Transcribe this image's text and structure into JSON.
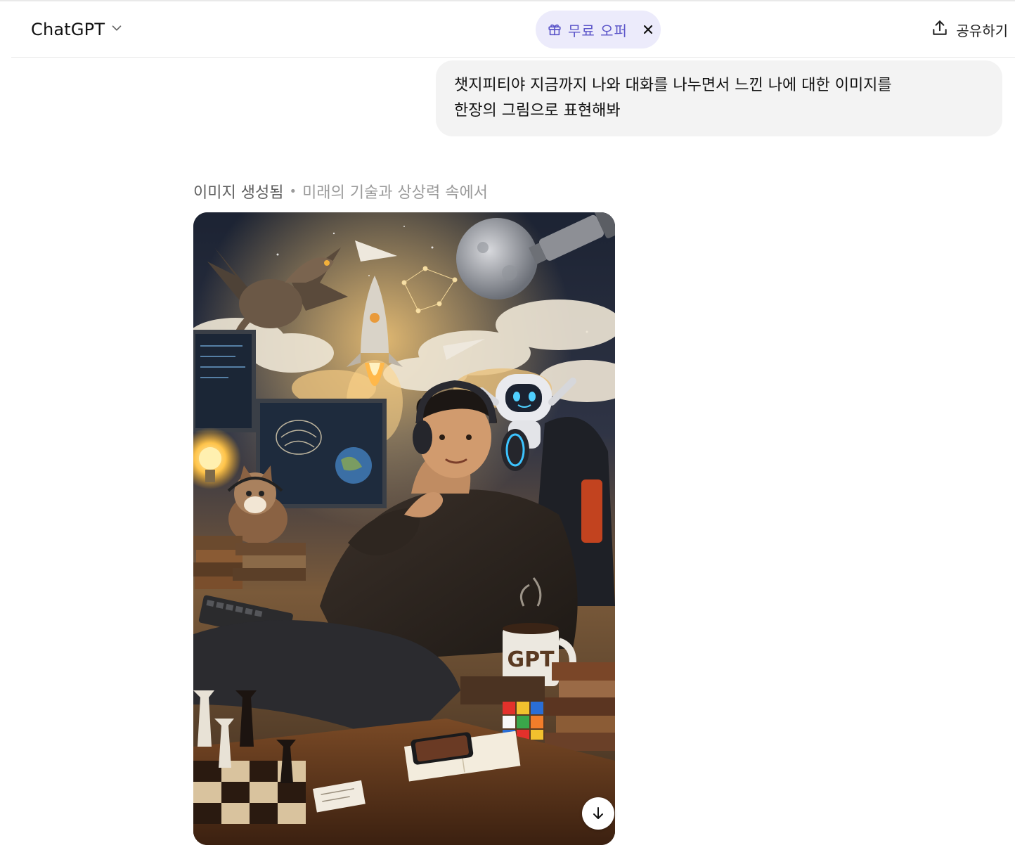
{
  "header": {
    "model_label": "ChatGPT",
    "offer_label": "무료 오퍼",
    "share_label": "공유하기"
  },
  "conversation": {
    "user_message_line1": "챗지피티야 지금까지 나와 대화를 나누면서 느낀 나에 대한 이미지를",
    "user_message_line2": "한장의 그림으로 표현해봐",
    "generated": {
      "status": "이미지 생성됨",
      "separator": "•",
      "subtitle": "미래의 기술과 상상력 속에서",
      "mug_text": "GPT"
    }
  },
  "colors": {
    "offer_bg": "#ecebfb",
    "offer_text": "#5b55c9",
    "bubble_bg": "#f3f3f3"
  }
}
